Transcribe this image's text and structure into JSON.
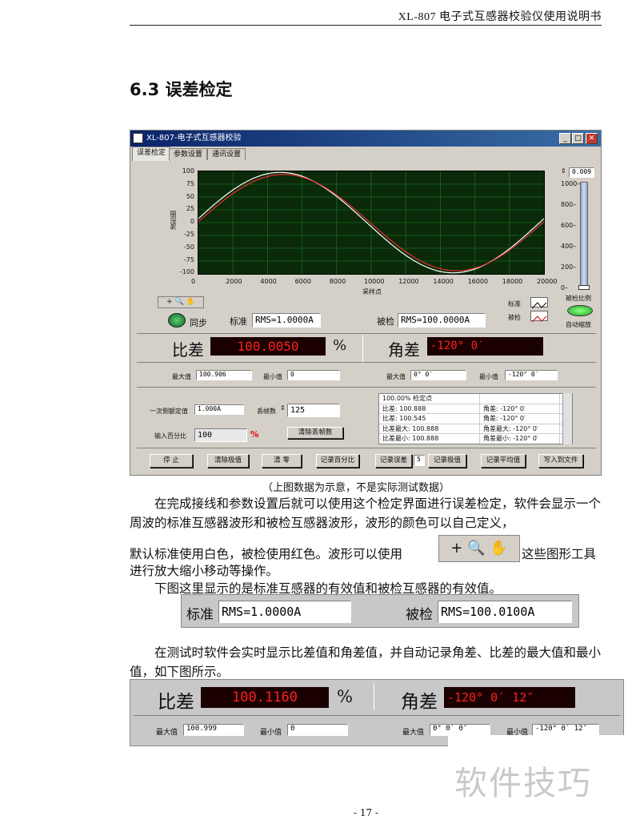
{
  "page_header": "XL-807 电子式互感器校验仪使用说明书",
  "section_title": "6.3 误差检定",
  "app": {
    "window_title": "XL-807-电子式互感器校验",
    "tabs": [
      "误差检定",
      "参数设置",
      "通讯设置"
    ],
    "plot": {
      "ylabel": "波形图",
      "xlabel": "采样点",
      "yticks": [
        "100",
        "75",
        "50",
        "25",
        "0",
        "-25",
        "-50",
        "-75",
        "-100"
      ],
      "xticks": [
        "0",
        "2000",
        "4000",
        "6000",
        "8000",
        "10000",
        "12000",
        "14000",
        "16000",
        "18000",
        "20000"
      ],
      "legend_std": "标准",
      "legend_test": "被检"
    },
    "scale": {
      "value": "0.009",
      "ticks": [
        "1000",
        "800",
        "600",
        "400",
        "200",
        "0"
      ],
      "label": "被检比例",
      "auto_zoom": "自动缩放"
    },
    "tools_label": "+ 🔍 ✋",
    "sync_label": "同步",
    "std_label": "标准",
    "std_value": "RMS=1.0000A",
    "test_label": "被检",
    "test_value": "RMS=100.0000A",
    "ratio_label": "比差",
    "ratio_value": "100.0050",
    "ratio_unit": "%",
    "angle_label": "角差",
    "angle_value": "-120° 0′",
    "ratio_max_label": "最大值",
    "ratio_max": "100.906",
    "ratio_min_label": "最小值",
    "ratio_min": "0",
    "angle_max_label": "最大值",
    "angle_max": "0° 0′",
    "angle_min_label": "最小值",
    "angle_min": "-120° 0′",
    "primary_label": "一次侧额定值",
    "primary_value": "1.000A",
    "drop_label": "丢帧数",
    "drop_value": "125",
    "input_label": "输入百分比",
    "input_value": "100",
    "input_unit": "%",
    "clear_drop_btn": "清除丢帧数",
    "list_rows": [
      [
        "100.00% 检定点",
        ""
      ],
      [
        "比差:  100.888",
        "角差:  -120° 0′"
      ],
      [
        "比差:  100.545",
        "角差:  -120° 0′"
      ],
      [
        "比差最大: 100.888",
        "角差最大: -120° 0′"
      ],
      [
        "比差最小: 100.888",
        "角差最小: -120° 0′"
      ]
    ],
    "buttons": [
      "停 止",
      "清除极值",
      "清 零",
      "记录百分比",
      "记录误差",
      "记录极值",
      "记录平均值",
      "写入到文件"
    ],
    "record_count": "5"
  },
  "caption": "（上图数据为示意，不是实际测试数据）",
  "para1_a": "在完成接线和参数设置后就可以使用这个检定界面进行误差检定，软件会显示一个周波的标准互感器波形和被检互感器波形，波形的颜色可以自己定义，",
  "para1_b": "默认标准使用白色，被检使用红色。波形可以使用",
  "para1_c": "这些图形工具",
  "para1_d": "进行放大缩小移动等操作。",
  "para2": "下图这里显示的是标准互感器的有效值和被检互感器的有效值。",
  "rms_strip": {
    "std_label": "标准",
    "std_value": "RMS=1.0000A",
    "test_label": "被检",
    "test_value": "RMS=100.0100A"
  },
  "para3": "在测试时软件会实时显示比差值和角差值，并自动记录角差、比差的最大值和最小值，如下图所示。",
  "err_strip": {
    "ratio_label": "比差",
    "ratio_value": "100.1160",
    "ratio_unit": "%",
    "angle_label": "角差",
    "angle_value": "-120° 0′ 12″",
    "ratio_max_label": "最大值",
    "ratio_max": "100.999",
    "ratio_min_label": "最小值",
    "ratio_min": "0",
    "angle_max_label": "最大值",
    "angle_max": "0° 0′ 0″",
    "angle_min_label": "最小值",
    "angle_min": "-120° 0′ 12″"
  },
  "watermark": "软件技巧",
  "page_number": "- 17 -"
}
